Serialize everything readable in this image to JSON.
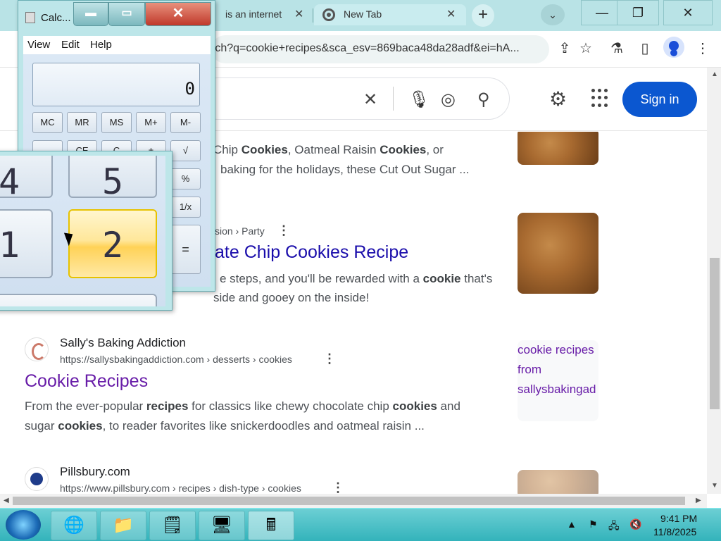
{
  "browser": {
    "tabs": [
      {
        "title": "is an internet",
        "close": "✕"
      },
      {
        "title": "New Tab",
        "close": "✕"
      }
    ],
    "new_tab": "+",
    "tab_search": "⌄",
    "window_controls": {
      "minimize": "—",
      "maximize": "❐",
      "close": "✕"
    },
    "address": "rch?q=cookie+recipes&sca_esv=869baca48da28adf&ei=hA...",
    "menu": "⋮"
  },
  "google": {
    "sign_in": "Sign in",
    "clear": "✕"
  },
  "results": [
    {
      "snippet_lines": [
        "Chip Cookies, Oatmeal Raisin Cookies, or",
        "baking for the holidays, these Cut Out Sugar ..."
      ]
    },
    {
      "breadcrumb": "sion › Party",
      "title": "ate Chip Cookies Recipe",
      "snippet_lines": [
        "e steps, and you'll be rewarded with a cookie that's",
        "side and gooey on the inside!"
      ]
    },
    {
      "site": "Sally's Baking Addiction",
      "url": "https://sallysbakingaddiction.com › desserts › cookies",
      "title": "Cookie Recipes",
      "snippet_lines": [
        "From the ever-popular recipes for classics like chewy chocolate chip cookies and",
        "sugar cookies, to reader favorites like snickerdoodles and oatmeal raisin ..."
      ],
      "thumb_alt": "cookie recipes from sallysbakingad"
    },
    {
      "site": "Pillsbury.com",
      "url": "https://www.pillsbury.com › recipes › dish-type › cookies"
    }
  ],
  "calculator": {
    "title": "Calc...",
    "menu": [
      "View",
      "Edit",
      "Help"
    ],
    "display": "0",
    "memory_keys": [
      "MC",
      "MR",
      "MS",
      "M+",
      "M-"
    ],
    "row2_keys": [
      "←",
      "CE",
      "C",
      "±",
      "√"
    ],
    "side_keys": [
      "%",
      "1/x",
      "="
    ],
    "zoom_keys": {
      "four": "4",
      "five": "5",
      "one": "1",
      "two": "2"
    }
  },
  "taskbar": {
    "time": "9:41 PM",
    "date": "11/8/2025"
  }
}
